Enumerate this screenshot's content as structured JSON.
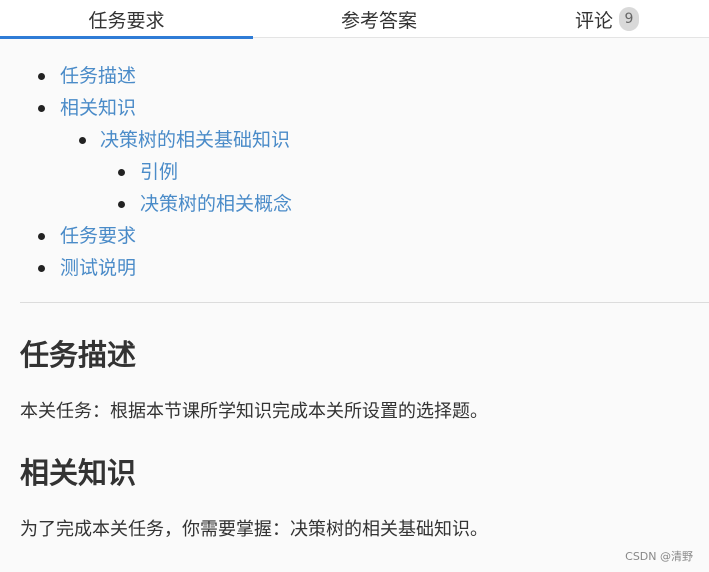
{
  "tabs": [
    {
      "label": "任务要求",
      "active": true
    },
    {
      "label": "参考答案",
      "active": false
    },
    {
      "label": "评论",
      "badge": "9",
      "active": false
    }
  ],
  "toc": {
    "items": [
      {
        "label": "任务描述",
        "level": 1
      },
      {
        "label": "相关知识",
        "level": 1
      },
      {
        "label": "决策树的相关基础知识",
        "level": 2
      },
      {
        "label": "引例",
        "level": 3
      },
      {
        "label": "决策树的相关概念",
        "level": 3
      },
      {
        "label": "任务要求",
        "level": 1
      },
      {
        "label": "测试说明",
        "level": 1
      }
    ]
  },
  "content": {
    "section1_title": "任务描述",
    "section1_text": "本关任务：根据本节课所学知识完成本关所设置的选择题。",
    "section2_title": "相关知识",
    "section2_text": "为了完成本关任务，你需要掌握：决策树的相关基础知识。"
  },
  "watermark": "CSDN @清野",
  "colors": {
    "accent": "#2f7cd6",
    "link": "#4a8bc8",
    "text": "#333333",
    "background": "#fafafa"
  }
}
